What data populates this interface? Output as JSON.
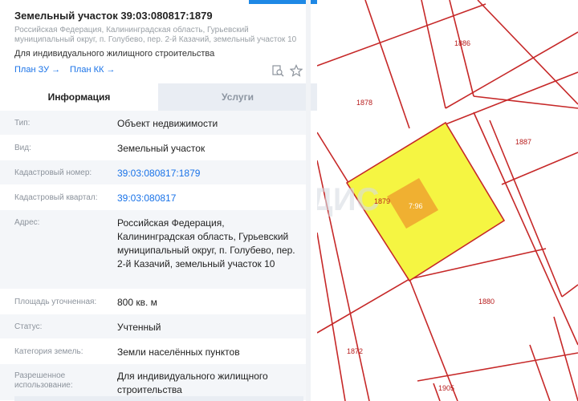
{
  "plot": {
    "title": "Земельный участок 39:03:080817:1879",
    "address_small": "Российская Федерация, Калининградская область, Гурьевский муниципальный округ, п. Голубево, пер. 2-й Казачий, земельный участок 10",
    "purpose": "Для индивидуального жилищного строительства",
    "links": {
      "plan_zu": "План ЗУ →",
      "plan_kk": "План КК →"
    }
  },
  "tabs": {
    "info": "Информация",
    "services": "Услуги"
  },
  "rows": [
    {
      "label": "Тип:",
      "value": "Объект недвижимости"
    },
    {
      "label": "Вид:",
      "value": "Земельный участок"
    },
    {
      "label": "Кадастровый номер:",
      "value": "39:03:080817:1879"
    },
    {
      "label": "Кадастровый квартал:",
      "value": "39:03:080817"
    },
    {
      "label": "Адрес:",
      "value": "Российская Федерация, Калининградская область, Гурьевский муниципальный округ, п. Голубево, пер. 2-й Казачий, земельный участок 10"
    },
    {
      "label": "Площадь уточненная:",
      "value": "800 кв. м"
    },
    {
      "label": "Статус:",
      "value": "Учтенный"
    },
    {
      "label": "Категория земель:",
      "value": "Земли населённых пунктов"
    },
    {
      "label": "Разрешенное использование:",
      "value": "Для индивидуального жилищного строительства"
    }
  ],
  "map": {
    "parcels": {
      "p1886": "1886",
      "p1878": "1878",
      "p1887": "1887",
      "p1879": "1879",
      "building": "7:96",
      "p1880": "1880",
      "p1872": "1872",
      "p1905": "1905"
    },
    "watermark": "ВЛАДИС",
    "colors": {
      "selected_fill": "#f5f542",
      "building_fill": "#f0a830",
      "boundary": "#c62828"
    }
  },
  "icons": {
    "doc_search": "doc-search-icon",
    "favorite": "star-icon"
  }
}
